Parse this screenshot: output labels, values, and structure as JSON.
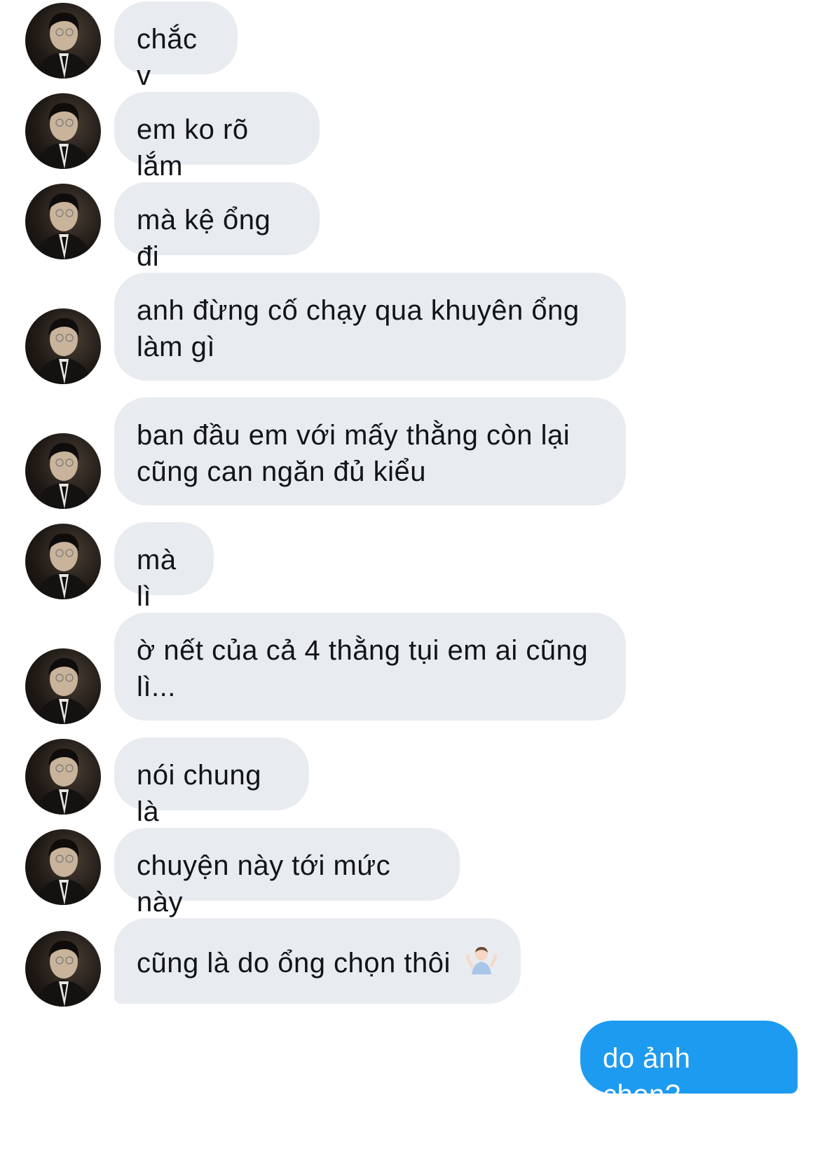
{
  "conversation": {
    "received": [
      {
        "text": "chắc v"
      },
      {
        "text": "em ko rõ lắm"
      },
      {
        "text": "mà kệ ổng đi"
      },
      {
        "text": "anh đừng cố chạy qua khuyên ổng làm gì"
      },
      {
        "text": "ban đầu em với mấy thằng còn lại cũng can ngăn đủ kiểu"
      },
      {
        "text": "mà lì"
      },
      {
        "text": "ờ nết của cả 4 thằng tụi em ai cũng lì..."
      },
      {
        "text": "nói chung là"
      },
      {
        "text": "chuyện này tới mức này"
      },
      {
        "text": "cũng là do ổng chọn thôi",
        "emoji": "person-shrugging-icon"
      }
    ],
    "sent": [
      {
        "text": "do ảnh chọn?"
      }
    ]
  },
  "colors": {
    "received_bubble": "#e8ebef",
    "sent_bubble": "#1d9bf0",
    "text_dark": "#111418",
    "text_light": "#ffffff"
  }
}
